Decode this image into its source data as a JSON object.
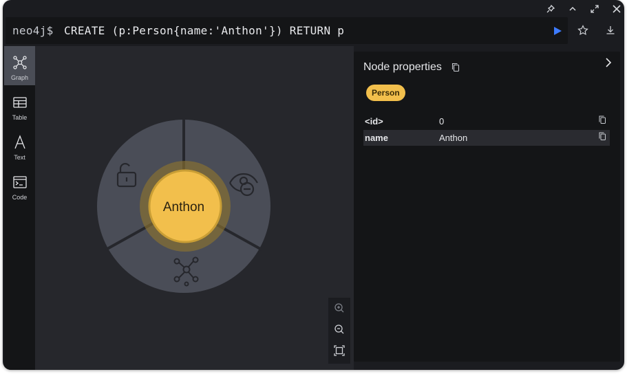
{
  "window": {
    "controls": [
      "pin-icon",
      "chevron-up-icon",
      "expand-icon",
      "close-icon"
    ]
  },
  "query": {
    "prompt": "neo4j$",
    "text": "CREATE (p:Person{name:'Anthon'}) RETURN p"
  },
  "sidebar": {
    "items": [
      {
        "label": "Graph",
        "icon": "graph-icon",
        "active": true
      },
      {
        "label": "Table",
        "icon": "table-icon",
        "active": false
      },
      {
        "label": "Text",
        "icon": "text-icon",
        "active": false
      },
      {
        "label": "Code",
        "icon": "code-icon",
        "active": false
      }
    ]
  },
  "graph": {
    "node_label": "Anthon",
    "node_color": "#f2bf4c",
    "ring_menu": [
      "unlock-icon",
      "hide-icon",
      "expand-relationships-icon"
    ]
  },
  "panel": {
    "title": "Node properties",
    "label_badge": "Person",
    "properties": [
      {
        "key": "<id>",
        "value": "0"
      },
      {
        "key": "name",
        "value": "Anthon"
      }
    ]
  },
  "colors": {
    "accent_run": "#3d7bff",
    "node_fill": "#f2bf4c",
    "badge": "#f2bf4c"
  }
}
